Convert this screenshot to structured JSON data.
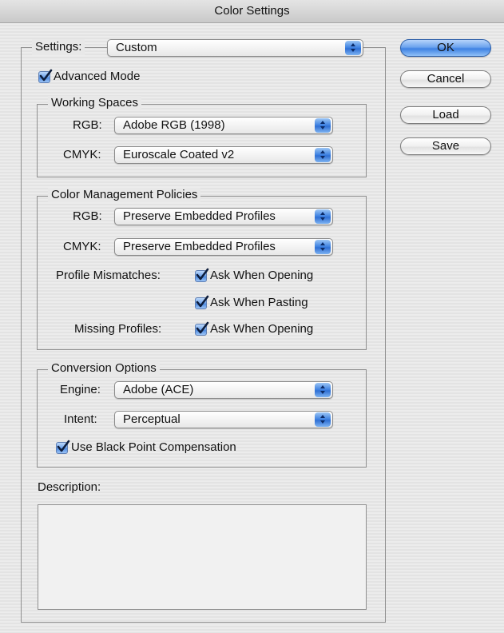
{
  "window": {
    "title": "Color Settings"
  },
  "settings": {
    "label": "Settings:",
    "value": "Custom"
  },
  "advanced_mode": {
    "label": "Advanced Mode",
    "checked": true
  },
  "working_spaces": {
    "title": "Working Spaces",
    "rgb_label": "RGB:",
    "rgb_value": "Adobe RGB (1998)",
    "cmyk_label": "CMYK:",
    "cmyk_value": "Euroscale Coated v2"
  },
  "policies": {
    "title": "Color Management Policies",
    "rgb_label": "RGB:",
    "rgb_value": "Preserve Embedded Profiles",
    "cmyk_label": "CMYK:",
    "cmyk_value": "Preserve Embedded Profiles",
    "mismatch_label": "Profile Mismatches:",
    "ask_opening": "Ask When Opening",
    "ask_pasting": "Ask When Pasting",
    "missing_label": "Missing Profiles:",
    "missing_ask_opening": "Ask When Opening"
  },
  "conversion": {
    "title": "Conversion Options",
    "engine_label": "Engine:",
    "engine_value": "Adobe (ACE)",
    "intent_label": "Intent:",
    "intent_value": "Perceptual",
    "bpc_label": "Use Black Point Compensation"
  },
  "description": {
    "label": "Description:",
    "text": ""
  },
  "buttons": {
    "ok": "OK",
    "cancel": "Cancel",
    "load": "Load",
    "save": "Save"
  },
  "colors": {
    "accent": "#3e82e3",
    "window_bg": "#ebebeb"
  },
  "icons": {
    "popup": "up-down-arrows-icon",
    "check": "checkmark-icon"
  }
}
